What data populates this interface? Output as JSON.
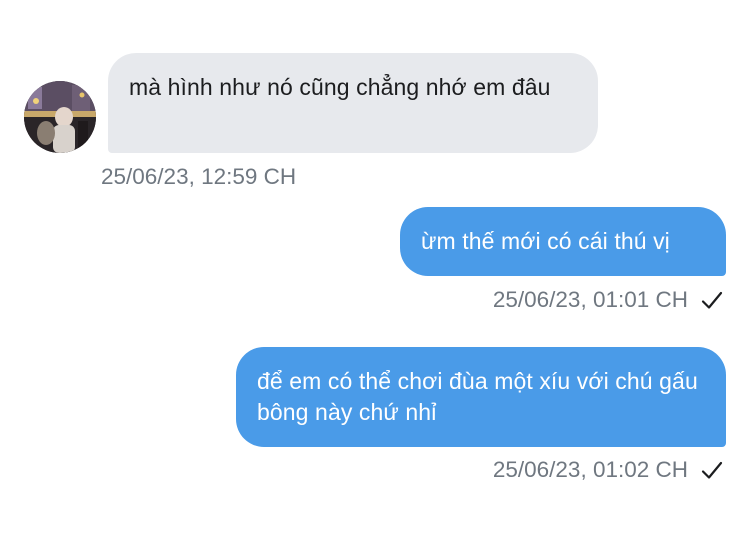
{
  "colors": {
    "incoming_bubble": "#e7e9ed",
    "outgoing_bubble": "#4a9be8",
    "timestamp": "#6f7780",
    "check": "#1c1d1f"
  },
  "messages": [
    {
      "direction": "incoming",
      "text": "mà hình như nó cũng chẳng nhớ em đâu",
      "time": "25/06/23, 12:59 CH",
      "has_avatar": true
    },
    {
      "direction": "outgoing",
      "text": "ừm thế mới có cái thú vị",
      "time": "25/06/23, 01:01 CH",
      "status_icon": "check-icon"
    },
    {
      "direction": "outgoing",
      "text": "để em có thể chơi đùa một xíu với chú gấu bông này chứ nhỉ",
      "time": "25/06/23, 01:02 CH",
      "status_icon": "check-icon"
    }
  ]
}
